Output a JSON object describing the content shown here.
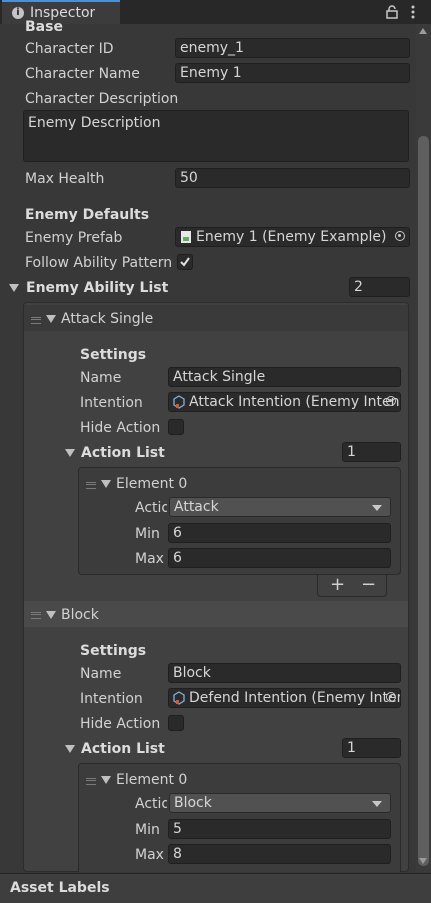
{
  "tab": {
    "title": "Inspector"
  },
  "base_section": {
    "header": "Base"
  },
  "fields": {
    "character_id": {
      "label": "Character ID",
      "value": "enemy_1"
    },
    "character_name": {
      "label": "Character Name",
      "value": "Enemy 1"
    },
    "character_description": {
      "label": "Character Description",
      "value": "Enemy Description"
    },
    "max_health": {
      "label": "Max Health",
      "value": "50"
    }
  },
  "enemy_defaults": {
    "header": "Enemy Defaults",
    "enemy_prefab_label": "Enemy Prefab",
    "enemy_prefab_value": "Enemy 1 (Enemy Example)",
    "follow_pattern_label": "Follow Ability Pattern",
    "follow_pattern_checked": true
  },
  "ability_list": {
    "label": "Enemy Ability List",
    "count": "2",
    "items": [
      {
        "title": "Attack Single",
        "settings_label": "Settings",
        "name_label": "Name",
        "name_value": "Attack Single",
        "intention_label": "Intention",
        "intention_value": "Attack Intention (Enemy Intention)",
        "hide_action_label": "Hide Action",
        "action_list_label": "Action List",
        "action_list_count": "1",
        "element": {
          "title": "Element 0",
          "action_label": "Action",
          "action_value": "Attack",
          "min_label": "Min",
          "min_value": "6",
          "max_label": "Max",
          "max_value": "6"
        }
      },
      {
        "title": "Block",
        "settings_label": "Settings",
        "name_label": "Name",
        "name_value": "Block",
        "intention_label": "Intention",
        "intention_value": "Defend Intention (Enemy Intention)",
        "hide_action_label": "Hide Action",
        "action_list_label": "Action List",
        "action_list_count": "1",
        "element": {
          "title": "Element 0",
          "action_label": "Action",
          "action_value": "Block",
          "min_label": "Min",
          "min_value": "5",
          "max_label": "Max",
          "max_value": "8"
        }
      }
    ]
  },
  "list_buttons": {
    "add": "+",
    "remove": "−"
  },
  "footer": {
    "asset_labels": "Asset Labels"
  },
  "colors": {
    "background": "#383838",
    "field": "#2a2a2a",
    "text": "#d2d2d2",
    "tab": "#3c3c3c"
  },
  "icons": [
    "info-icon",
    "lock-icon",
    "kebab-menu-icon",
    "prefab-icon",
    "scriptable-object-icon",
    "checkmark-icon",
    "foldout-icon",
    "drag-handle-icon",
    "object-picker-icon",
    "dropdown-arrow-icon",
    "scroll-up-icon",
    "scroll-down-icon"
  ]
}
